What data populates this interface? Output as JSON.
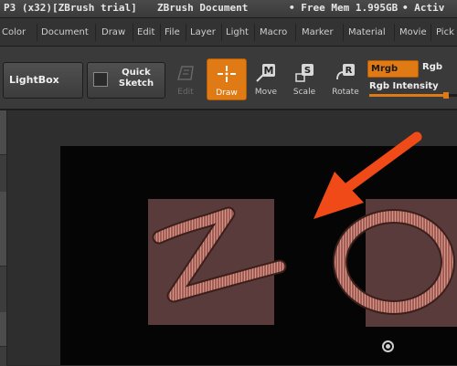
{
  "window": {
    "app_title": "P3 (x32)[ZBrush trial]",
    "doc_title": "ZBrush Document",
    "mem_text": "• Free Mem 1.995GB",
    "active_text": "• Activ"
  },
  "menu": {
    "items": [
      "Color",
      "Document",
      "Draw",
      "Edit",
      "File",
      "Layer",
      "Light",
      "Macro",
      "Marker",
      "Material",
      "Movie",
      "Pick"
    ]
  },
  "toolbar": {
    "lightbox_label": "LightBox",
    "quick_sketch_line1": "Quick",
    "quick_sketch_line2": "Sketch",
    "edit_label": "Edit",
    "draw_label": "Draw",
    "move_label": "Move",
    "scale_label": "Scale",
    "rotate_label": "Rotate",
    "move_key": "M",
    "scale_key": "S",
    "rotate_key": "R",
    "mrgb_label": "Mrgb",
    "rgb_label": "Rgb",
    "rgb_intensity_label": "Rgb Intensity",
    "rgb_intensity_level": 0.88
  },
  "colors": {
    "accent": "#e07a14",
    "arrow": "#f04a18",
    "selection": "#5a3b3b",
    "stroke": "#b86a5e"
  },
  "icons": {
    "draw": "crosshair-icon",
    "move": "move-icon",
    "scale": "scale-icon",
    "rotate": "rotate-icon",
    "edit": "edit-icon",
    "quick_sketch": "sketch-icon",
    "gizmo": "target-icon"
  }
}
